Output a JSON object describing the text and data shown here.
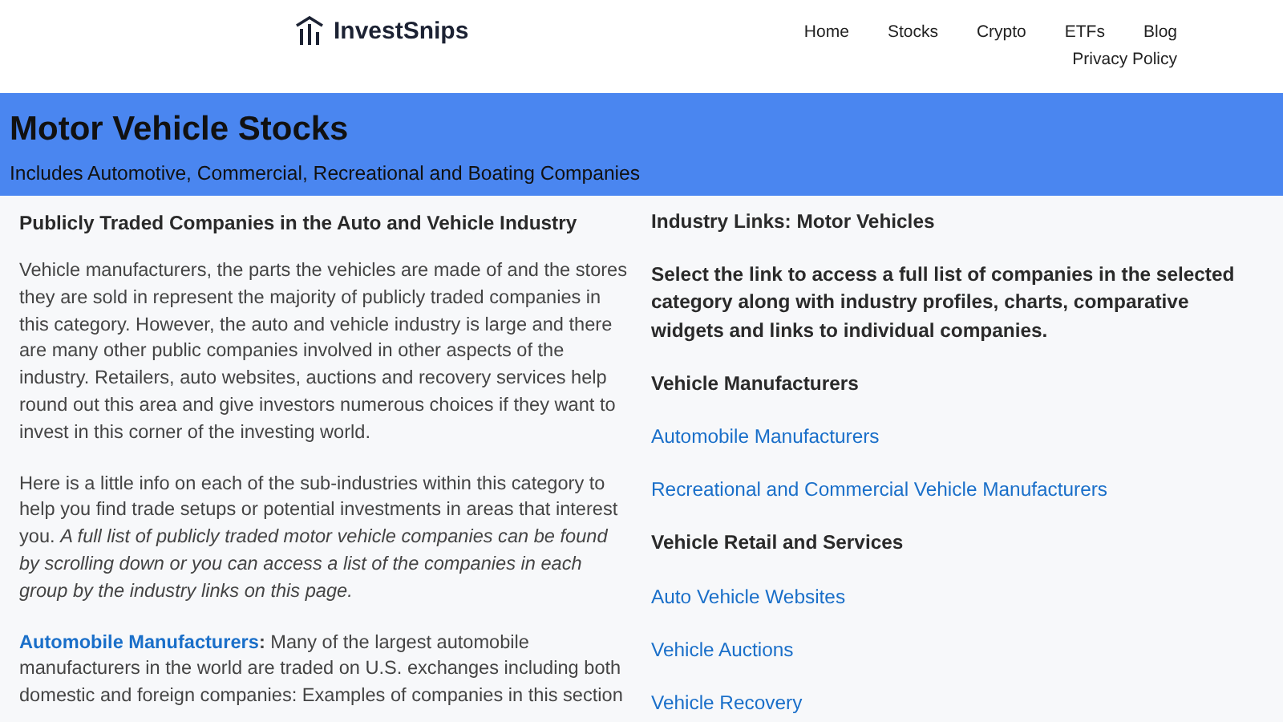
{
  "header": {
    "logo": "InvestSnips",
    "nav": [
      {
        "label": "Home"
      },
      {
        "label": "Stocks"
      },
      {
        "label": "Crypto"
      },
      {
        "label": "ETFs"
      },
      {
        "label": "Blog"
      },
      {
        "label": "Privacy Policy"
      }
    ]
  },
  "banner": {
    "title": "Motor Vehicle Stocks",
    "subtitle": "Includes Automotive, Commercial, Recreational and Boating Companies"
  },
  "left": {
    "heading": "Publicly Traded Companies in the Auto and Vehicle Industry",
    "paragraphs": [
      {
        "text": "Vehicle manufacturers, the parts the vehicles are made of and the stores they are sold in represent the majority of publicly traded companies in this category. However, the auto and vehicle industry is large and there are many other public companies involved in other aspects of the industry. Retailers, auto websites, auctions and recovery services help round out this area and give investors numerous choices if they want to invest in this corner of the investing world."
      },
      {
        "text": "Here is a little info on each of the sub-industries within this category to help you find trade setups or potential investments in areas that interest you. *A full list of publicly traded motor vehicle companies can be found by scrolling down or you can access a list of the companies in each group by the industry links on this page.*"
      },
      {
        "link": "Automobile Manufacturers",
        "text": "**:** Many of the largest automobile manufacturers in the world are traded on U.S. exchanges including both domestic and foreign companies: Examples of companies in this section"
      }
    ]
  },
  "right": {
    "items": [
      {
        "kind": "heading",
        "text": "Industry Links: Motor Vehicles"
      },
      {
        "kind": "intro",
        "text": "Select the link to access a full list of companies in the selected category along with industry profiles, charts, comparative widgets and links to individual companies."
      },
      {
        "kind": "heading",
        "text": "Vehicle Manufacturers"
      },
      {
        "kind": "link",
        "text": "Automobile Manufacturers"
      },
      {
        "kind": "link",
        "text": "Recreational and Commercial Vehicle Manufacturers"
      },
      {
        "kind": "heading",
        "text": "Vehicle Retail and Services"
      },
      {
        "kind": "link",
        "text": "Auto Vehicle Websites"
      },
      {
        "kind": "link",
        "text": "Vehicle Auctions"
      },
      {
        "kind": "link",
        "text": "Vehicle Recovery"
      }
    ]
  }
}
